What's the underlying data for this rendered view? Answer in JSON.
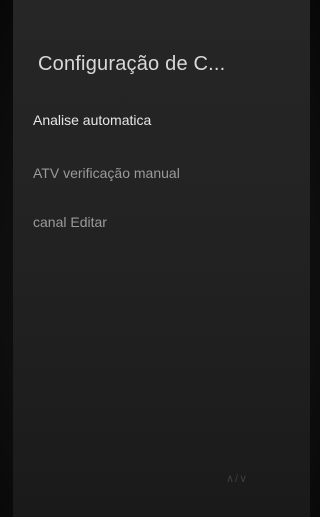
{
  "screen": {
    "title": "Configuração de C..."
  },
  "menu": {
    "items": [
      {
        "label": "Analise automatica",
        "state": "selected"
      },
      {
        "label": "ATV verificação manual",
        "state": "normal"
      },
      {
        "label": "canal Editar",
        "state": "normal"
      }
    ]
  },
  "footer": {
    "hint": "∧/∨"
  },
  "colors": {
    "background": "#111111",
    "panel": "#242424",
    "title": "#d8d8d8",
    "selected_text": "#e6e6e6",
    "normal_text": "#9a9a9a"
  }
}
